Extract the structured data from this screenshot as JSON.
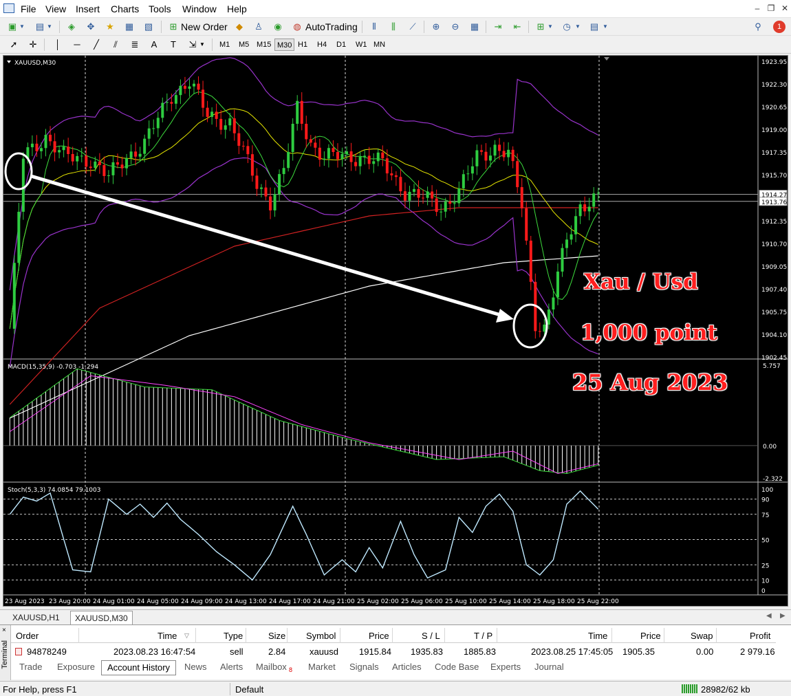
{
  "menu": [
    "File",
    "View",
    "Insert",
    "Charts",
    "Tools",
    "Window",
    "Help"
  ],
  "toolbar": {
    "new_order": "New Order",
    "autotrading": "AutoTrading",
    "notification_count": "1"
  },
  "timeframes": [
    "M1",
    "M5",
    "M15",
    "M30",
    "H1",
    "H4",
    "D1",
    "W1",
    "MN"
  ],
  "active_timeframe": "M30",
  "chart": {
    "symbol_label": "XAUUSD,M30",
    "price_levels": [
      "1923.95",
      "1922.30",
      "1920.65",
      "1919.00",
      "1917.35",
      "1915.70",
      "1914.27",
      "1913.76",
      "1912.35",
      "1910.70",
      "1909.05",
      "1907.40",
      "1905.75",
      "1904.10",
      "1902.45"
    ],
    "macd_label": "MACD(15,35,9) -0.703 -1.294",
    "macd_levels": [
      "5.757",
      "0.00",
      "-2.322"
    ],
    "stoch_label": "Stoch(5,3,3) 74.0854 79.1003",
    "stoch_levels": [
      "100",
      "90",
      "75",
      "50",
      "25",
      "10",
      "0"
    ],
    "time_labels": [
      "23 Aug 2023",
      "23 Aug 20:00",
      "24 Aug 01:00",
      "24 Aug 05:00",
      "24 Aug 09:00",
      "24 Aug 13:00",
      "24 Aug 17:00",
      "24 Aug 21:00",
      "25 Aug 02:00",
      "25 Aug 06:00",
      "25 Aug 10:00",
      "25 Aug 14:00",
      "25 Aug 18:00",
      "25 Aug 22:00"
    ],
    "annotation_title": "Xau / Usd",
    "annotation_points": "1,000 point",
    "annotation_date": "25 Aug 2023",
    "colors": {
      "bull": "#2ecc40",
      "bear": "#ff1a1a",
      "ma_slow": "#ffffff",
      "ma_mid": "#d22222",
      "bands": "#9933cc",
      "ma_fast": "#e6e600",
      "ma_green": "#3ddc3d",
      "macd_signal": "#ff44ff",
      "stoch": "#bfe9ff"
    }
  },
  "chart_tabs": [
    "XAUUSD,H1",
    "XAUUSD,M30"
  ],
  "active_chart_tab": "XAUUSD,M30",
  "terminal": {
    "side_label": "Terminal",
    "headers": [
      "Order",
      "Time",
      "Type",
      "Size",
      "Symbol",
      "Price",
      "S / L",
      "T / P",
      "Time",
      "Price",
      "Swap",
      "Profit"
    ],
    "row": [
      "94878249",
      "2023.08.23 16:47:54",
      "sell",
      "2.84",
      "xauusd",
      "1915.84",
      "1935.83",
      "1885.83",
      "2023.08.25 17:45:05",
      "1905.35",
      "0.00",
      "2 979.16"
    ],
    "tabs": [
      "Trade",
      "Exposure",
      "Account History",
      "News",
      "Alerts",
      "Mailbox",
      "Market",
      "Signals",
      "Articles",
      "Code Base",
      "Experts",
      "Journal"
    ],
    "mailbox_count": "8",
    "active_tab": "Account History"
  },
  "status": {
    "help": "For Help, press F1",
    "profile": "Default",
    "traffic": "28982/62 kb"
  }
}
